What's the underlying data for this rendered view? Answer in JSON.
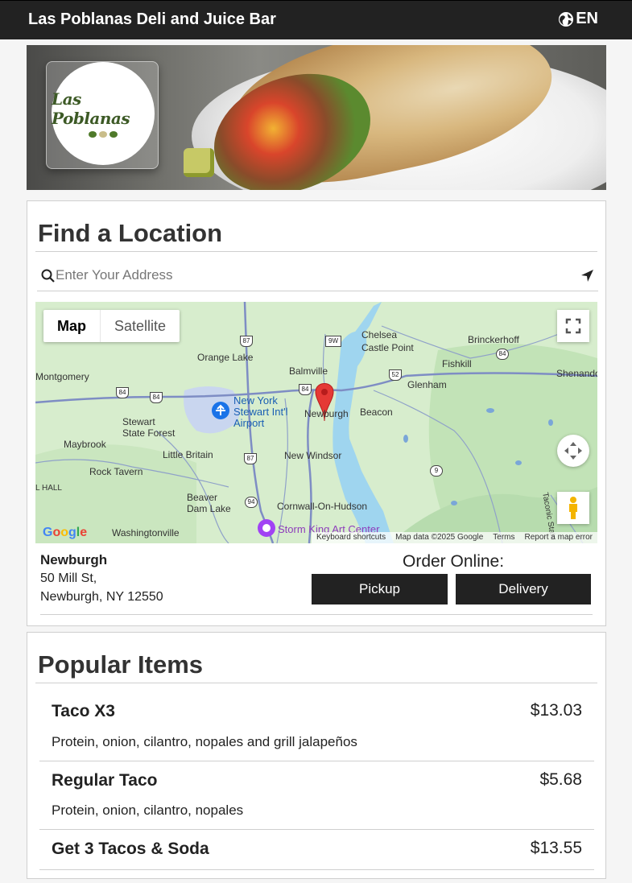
{
  "header": {
    "title": "Las Poblanas Deli and Juice Bar",
    "lang": "EN"
  },
  "hero": {
    "logo_text": "Las Poblanas"
  },
  "locations": {
    "heading": "Find a Location",
    "search_placeholder": "Enter Your Address",
    "map": {
      "toggle_map": "Map",
      "toggle_satellite": "Satellite",
      "labels": {
        "chelsea": "Chelsea",
        "castle_point": "Castle Point",
        "brinckerhoff": "Brinckerhoff",
        "orange_lake": "Orange Lake",
        "balmville": "Balmville",
        "fishkill": "Fishkill",
        "shenandoah": "Shenando",
        "montgomery": "Montgomery",
        "glenham": "Glenham",
        "airport": "New York\nStewart Int'l\nAirport",
        "newburgh": "Newburgh",
        "beacon": "Beacon",
        "stewart_forest": "Stewart\nState Forest",
        "maybrook": "Maybrook",
        "little_britain": "Little Britain",
        "new_windsor": "New Windsor",
        "rock_tavern": "Rock Tavern",
        "hall": "L HALL",
        "beaver_dam": "Beaver\nDam Lake",
        "cornwall": "Cornwall-On-Hudson",
        "washingtonville": "Washingtonville",
        "storm_king": "Storm King Art Center",
        "taconic": "Taconic State"
      },
      "shields": [
        "87",
        "9W",
        "84",
        "52",
        "84",
        "84",
        "84",
        "87",
        "9",
        "94",
        "84"
      ],
      "google": "Google",
      "footer": [
        "Keyboard shortcuts",
        "Map data ©2025 Google",
        "Terms",
        "Report a map error"
      ]
    },
    "location": {
      "name": "Newburgh",
      "street": "50 Mill St,",
      "city": "Newburgh, NY 12550"
    },
    "order_label": "Order Online:",
    "pickup": "Pickup",
    "delivery": "Delivery"
  },
  "popular": {
    "heading": "Popular Items",
    "items": [
      {
        "name": "Taco X3",
        "price": "$13.03",
        "desc": "Protein, onion, cilantro, nopales and grill jalapeños"
      },
      {
        "name": "Regular Taco",
        "price": "$5.68",
        "desc": "Protein, onion, cilantro, nopales"
      },
      {
        "name": "Get 3 Tacos & Soda",
        "price": "$13.55",
        "desc": ""
      }
    ]
  }
}
